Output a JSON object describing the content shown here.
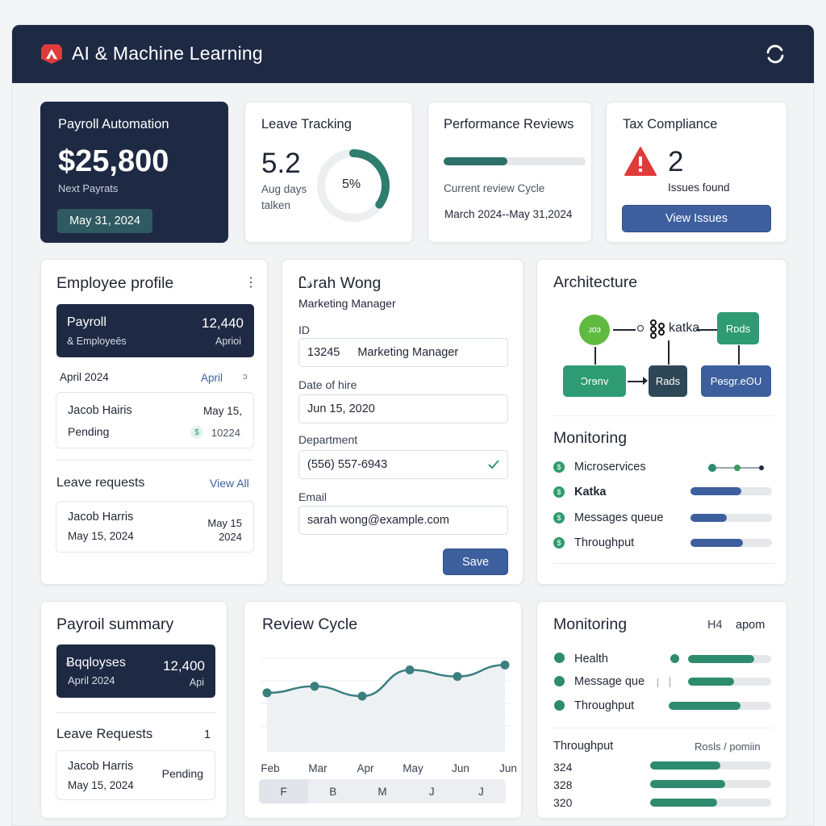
{
  "header": {
    "title": "AI & Machine Learning"
  },
  "payroll_automation": {
    "title": "Payroll Automation",
    "amount": "$25,800",
    "subtitle": "Next Payrats",
    "date": "May 31, 2024"
  },
  "leave_tracking": {
    "title": "Leave Tracking",
    "value": "5.2",
    "caption": "Aug days\ntalken",
    "percent_label": "5%",
    "progress": 0.35
  },
  "performance_reviews": {
    "title": "Performance Reviews",
    "progress": 0.45,
    "caption": "Current review Cycle",
    "period": "March 2024--May 31,2024"
  },
  "tax_compliance": {
    "title": "Tax Compliance",
    "count": "2",
    "caption": "Issues found",
    "button": "View Issues"
  },
  "employee_profile": {
    "title": "Employee profile",
    "banner": {
      "title": "Payroll",
      "value": "12,440",
      "sub": "& Employeēs",
      "right": "Aprioi"
    },
    "row": {
      "left": "April 2024",
      "right": "April",
      "mark": "ↄ"
    },
    "item": {
      "name": "Jacob Hairis",
      "date": "May 15,",
      "status": "Pending",
      "amount": "10224"
    },
    "leave_title": "Leave requests",
    "view_all": "View All",
    "leave_item": {
      "name": "Jacob Harris",
      "date": "May 15, 2024",
      "right1": "May 15",
      "right2": "2024"
    }
  },
  "profile_form": {
    "name": "Ꮭ𝓈rah Wong",
    "role": "Marketing Manager",
    "fields": [
      {
        "label": "ID",
        "value": "13245",
        "extra": "Marketing Manager"
      },
      {
        "label": "Date of hire",
        "value": "Jun 15, 2020"
      },
      {
        "label": "Department",
        "value": "(556) 557-6943"
      },
      {
        "label": "Email",
        "value": "sarah wong@example.com"
      }
    ],
    "save": "Save"
  },
  "architecture": {
    "title": "Architecture",
    "nodes": {
      "n1": "ᴊᴏɜ",
      "kafka": "katka",
      "redis_top": "Rᴅds",
      "n2": "Ɔrɘnv",
      "rads": "Rads",
      "postgres": "Pөsgr.eʘU"
    },
    "monitoring_title": "Monitoring",
    "rows": [
      {
        "label": "Microservices",
        "bold": false,
        "fill": null
      },
      {
        "label": "Katka",
        "bold": true,
        "fill": 0.62
      },
      {
        "label": "Messages queue",
        "bold": false,
        "fill": 0.45
      },
      {
        "label": "Throughput",
        "bold": false,
        "fill": 0.64
      }
    ]
  },
  "payroll_summary": {
    "title": "Payroil summary",
    "banner": {
      "title": "Ƀqqloyses",
      "value": "12,400",
      "sub": "April 2024",
      "right": "Api"
    },
    "leave_title": "Leave Requests",
    "leave_count": "1",
    "item": {
      "name": "Jacob Harris",
      "date": "May 15, 2024",
      "status": "Pending"
    }
  },
  "review_cycle": {
    "title": "Review Cycle",
    "x_labels": [
      "Feb",
      "Mar",
      "Apr",
      "May",
      "Jun",
      "Jun"
    ],
    "segments": [
      "F",
      "B",
      "M",
      "J",
      "J"
    ]
  },
  "monitoring2": {
    "title": "Monitoring",
    "h_label": "H4",
    "apom": "apom",
    "rows": [
      {
        "label": "Health",
        "fill": 0.8
      },
      {
        "label": "Message que",
        "fill": 0.55
      },
      {
        "label": "Throughput",
        "fill": 0.7
      }
    ],
    "throughput_title": "Throughput",
    "throughput_unit": "Rosls / pomiin",
    "throughput_rows": [
      {
        "label": "324",
        "fill": 0.58
      },
      {
        "label": "328",
        "fill": 0.62
      },
      {
        "label": "320",
        "fill": 0.55
      }
    ]
  },
  "chart_data": {
    "type": "area",
    "title": "Review Cycle",
    "categories": [
      "Feb",
      "Mar",
      "Apr",
      "May",
      "Jun",
      "Jun"
    ],
    "values": [
      3.2,
      3.6,
      3.0,
      4.6,
      4.2,
      4.9
    ],
    "ylim": [
      0,
      6
    ],
    "grid": true
  },
  "colors": {
    "navy": "#1e2a44",
    "green": "#2e8b6e",
    "blue": "#3d5f9e",
    "red": "#e03b3b"
  }
}
